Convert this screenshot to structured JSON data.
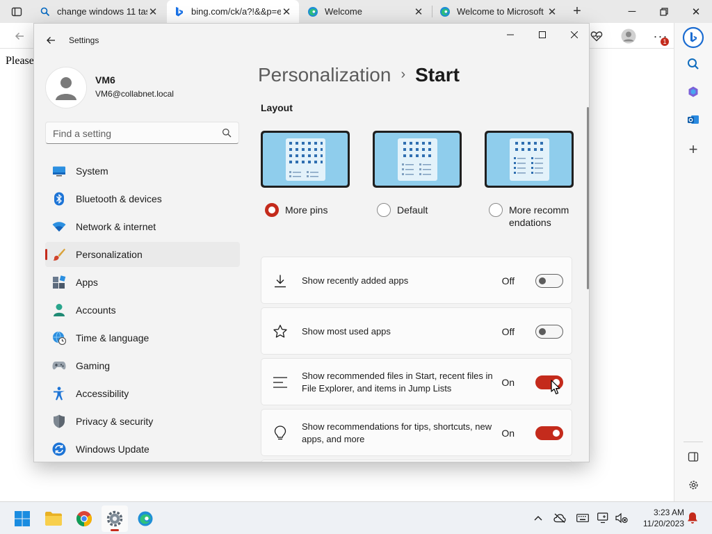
{
  "browser": {
    "tabs": [
      {
        "label": "change windows 11 tas",
        "icon": "search-icon"
      },
      {
        "label": "bing.com/ck/a?!&&p=e",
        "icon": "bing-icon"
      },
      {
        "label": "Welcome",
        "icon": "edge-icon"
      },
      {
        "label": "Welcome to Microsoft E",
        "icon": "edge-icon"
      }
    ],
    "page_text": "Please",
    "notification_badge": "1"
  },
  "settings": {
    "app_title": "Settings",
    "user": {
      "name": "VM6",
      "email": "VM6@collabnet.local"
    },
    "search_placeholder": "Find a setting",
    "nav": [
      {
        "label": "System",
        "icon": "system-icon"
      },
      {
        "label": "Bluetooth & devices",
        "icon": "bluetooth-icon"
      },
      {
        "label": "Network & internet",
        "icon": "wifi-icon"
      },
      {
        "label": "Personalization",
        "icon": "brush-icon",
        "selected": true
      },
      {
        "label": "Apps",
        "icon": "apps-icon"
      },
      {
        "label": "Accounts",
        "icon": "accounts-icon"
      },
      {
        "label": "Time & language",
        "icon": "clock-globe-icon"
      },
      {
        "label": "Gaming",
        "icon": "gamepad-icon"
      },
      {
        "label": "Accessibility",
        "icon": "accessibility-icon"
      },
      {
        "label": "Privacy & security",
        "icon": "shield-icon"
      },
      {
        "label": "Windows Update",
        "icon": "update-icon"
      }
    ],
    "breadcrumb": {
      "parent": "Personalization",
      "separator": "›",
      "current": "Start"
    },
    "layout_title": "Layout",
    "layout_options": [
      {
        "label": "More pins",
        "checked": true
      },
      {
        "label": "Default",
        "checked": false
      },
      {
        "label": "More recommendations",
        "checked": false
      }
    ],
    "cards": [
      {
        "label": "Show recently added apps",
        "state": "Off",
        "on": false,
        "icon": "download-icon"
      },
      {
        "label": "Show most used apps",
        "state": "Off",
        "on": false,
        "icon": "star-icon"
      },
      {
        "label": "Show recommended files in Start, recent files in File Explorer, and items in Jump Lists",
        "state": "On",
        "on": true,
        "icon": "list-icon"
      },
      {
        "label": "Show recommendations for tips, shortcuts, new apps, and more",
        "state": "On",
        "on": true,
        "icon": "lightbulb-icon"
      }
    ]
  },
  "taskbar": {
    "time": "3:23 AM",
    "date": "11/20/2023"
  },
  "colors": {
    "accent": "#c42b1c",
    "tile_blue": "#2f6fb1",
    "wallpaper": "#8fcdec"
  }
}
